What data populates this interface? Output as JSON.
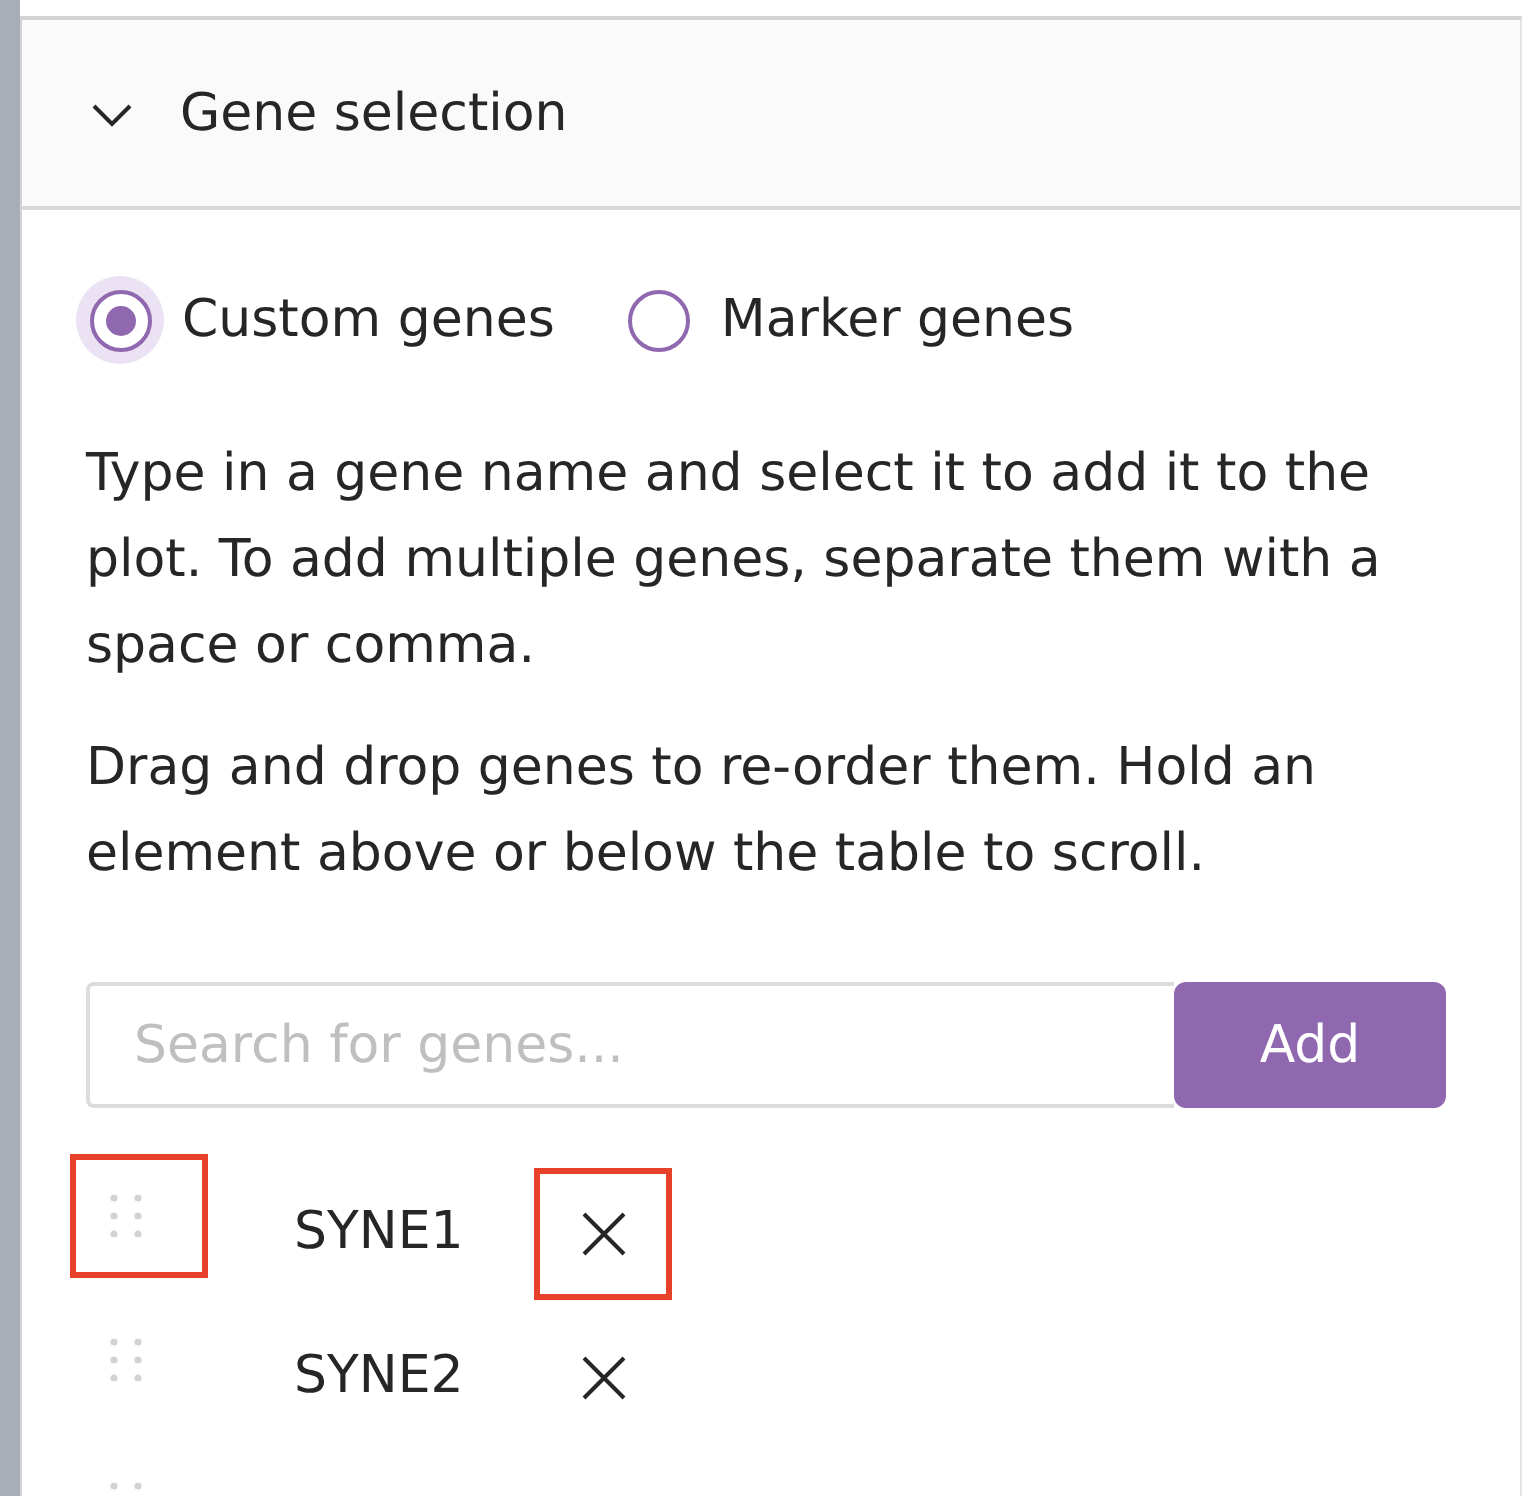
{
  "panel": {
    "title": "Gene selection",
    "expanded": true
  },
  "gene_source": [
    {
      "label": "Custom genes",
      "selected": true
    },
    {
      "label": "Marker genes",
      "selected": false
    }
  ],
  "instructions": [
    "Type in a gene name and select it to add it to the plot. To add multiple genes, separate them with a space or comma.",
    "Drag and drop genes to re-order them. Hold an element above or below the table to scroll."
  ],
  "search": {
    "placeholder": "Search for genes...",
    "button": "Add"
  },
  "genes": [
    {
      "name": "SYNE1",
      "handle_highlighted": true,
      "remove_highlighted": true
    },
    {
      "name": "SYNE2",
      "handle_highlighted": false,
      "remove_highlighted": false
    },
    {
      "handle_highlighted": false
    }
  ]
}
